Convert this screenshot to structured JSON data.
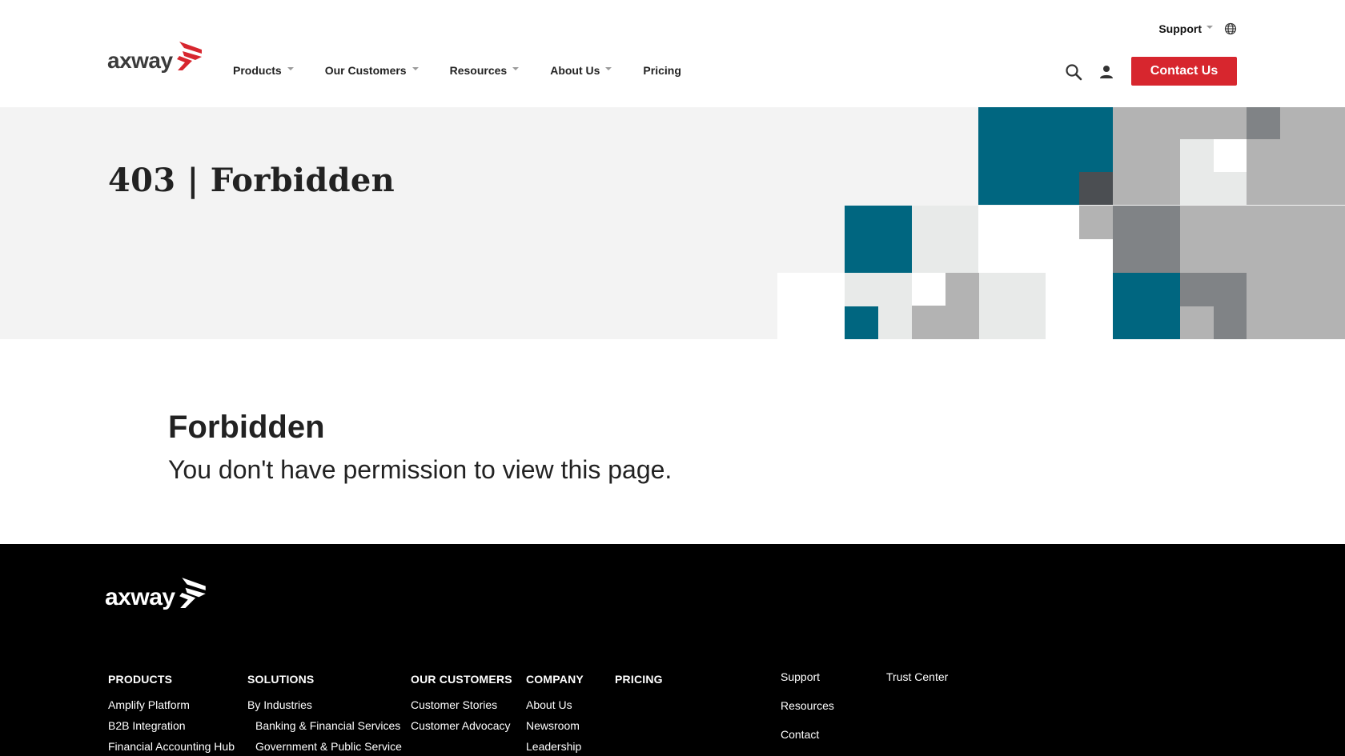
{
  "header": {
    "logo_text": "axway",
    "utility": {
      "support_label": "Support",
      "globe_icon": "globe-icon"
    },
    "nav": [
      {
        "label": "Products",
        "has_dropdown": true
      },
      {
        "label": "Our Customers",
        "has_dropdown": true
      },
      {
        "label": "Resources",
        "has_dropdown": true
      },
      {
        "label": "About Us",
        "has_dropdown": true
      },
      {
        "label": "Pricing",
        "has_dropdown": false
      }
    ],
    "search_icon": "search-icon",
    "user_icon": "user-icon",
    "contact_label": "Contact Us"
  },
  "hero": {
    "title": "403 | Forbidden"
  },
  "main": {
    "title": "Forbidden",
    "message": "You don't have permission to view this page."
  },
  "footer": {
    "logo_text": "axway",
    "columns": [
      {
        "heading": "PRODUCTS",
        "links": [
          "Amplify Platform",
          "B2B Integration",
          "Financial Accounting Hub"
        ]
      },
      {
        "heading": "SOLUTIONS",
        "links": [
          "By Industries",
          "Banking & Financial Services",
          "Government & Public Service"
        ]
      },
      {
        "heading": "OUR CUSTOMERS",
        "links": [
          "Customer Stories",
          "Customer Advocacy"
        ]
      },
      {
        "heading": "COMPANY",
        "links": [
          "About Us",
          "Newsroom",
          "Leadership"
        ]
      },
      {
        "heading": "PRICING",
        "links": []
      }
    ],
    "secondary_links_a": [
      "Support",
      "Resources",
      "Contact"
    ],
    "secondary_links_b": [
      "Trust Center"
    ]
  },
  "colors": {
    "brand_red": "#d7262e",
    "teal": "#006680",
    "hero_bg": "#f3f3f3",
    "footer_bg": "#000000"
  }
}
